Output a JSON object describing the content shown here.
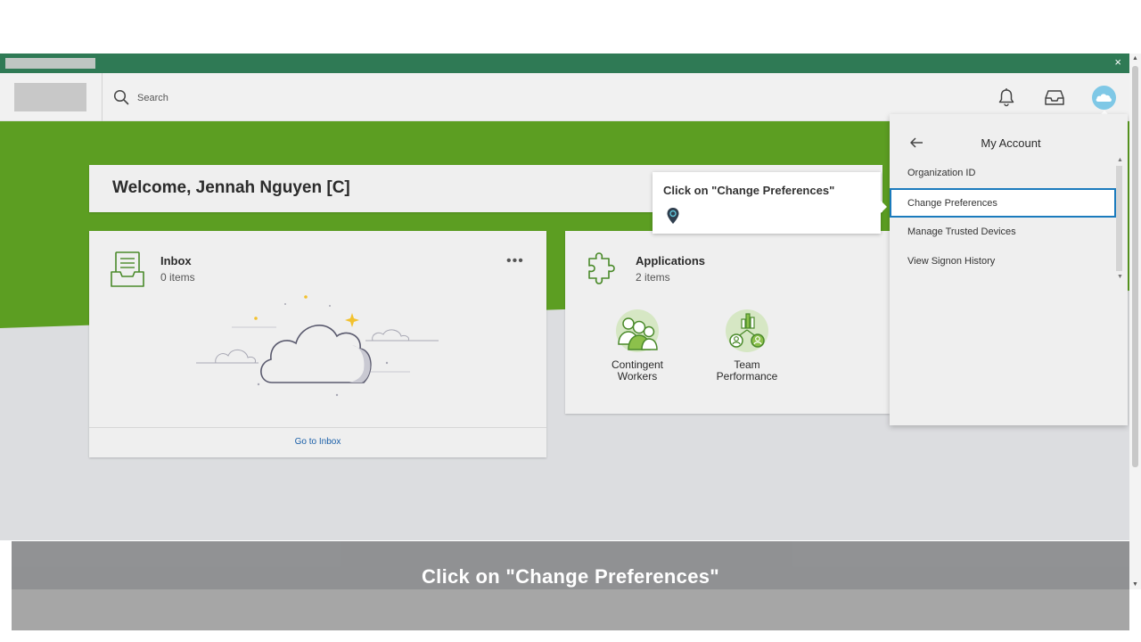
{
  "window": {
    "close_glyph": "×"
  },
  "header": {
    "search_placeholder": "Search",
    "icons": [
      "search-icon",
      "bell-icon",
      "inbox-tray-icon",
      "cloud-avatar-icon"
    ]
  },
  "welcome": {
    "text": "Welcome, Jennah Nguyen [C]"
  },
  "inbox_card": {
    "title": "Inbox",
    "count": "0 items",
    "more": "•••",
    "footer_link": "Go to Inbox"
  },
  "apps_card": {
    "title": "Applications",
    "count": "2 items",
    "apps": [
      {
        "label_line1": "Contingent",
        "label_line2": "Workers"
      },
      {
        "label_line1": "Team",
        "label_line2": "Performance"
      }
    ]
  },
  "tooltip": {
    "text": "Click on \"Change Preferences\""
  },
  "account_menu": {
    "title": "My Account",
    "items": [
      {
        "label": "Organization ID",
        "selected": false
      },
      {
        "label": "Change Preferences",
        "selected": true
      },
      {
        "label": "Manage Trusted Devices",
        "selected": false
      },
      {
        "label": "View Signon History",
        "selected": false
      }
    ]
  },
  "caption": {
    "text": "Click on \"Change Preferences\""
  },
  "colors": {
    "top_bar": "#2f7a55",
    "hero_green": "#5c9e22",
    "accent_blue": "#1b7bbd",
    "link_blue": "#1a5fa8",
    "icon_green": "#4a8a2a"
  }
}
